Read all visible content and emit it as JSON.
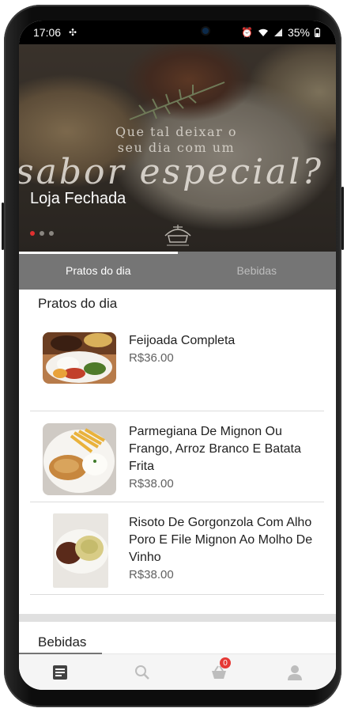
{
  "status_bar": {
    "time": "17:06",
    "battery": "35%"
  },
  "hero": {
    "line1": "Que tal deixar o seu dia com um",
    "line2": "sabor especial?",
    "store_status": "Loja Fechada"
  },
  "tabs": [
    {
      "label": "Pratos do dia",
      "active": true
    },
    {
      "label": "Bebidas",
      "active": false
    }
  ],
  "sections": {
    "pratos_title": "Pratos do dia",
    "bebidas_title": "Bebidas"
  },
  "menu_items": [
    {
      "name": "Feijoada Completa",
      "price": "R$36.00"
    },
    {
      "name": "Parmegiana De Mignon Ou Frango, Arroz Branco E Batata Frita",
      "price": "R$38.00"
    },
    {
      "name": "Risoto De Gorgonzola Com Alho Poro E File Mignon Ao Molho De Vinho",
      "price": "R$38.00"
    }
  ],
  "bottom_nav": {
    "items": [
      "menu-icon",
      "search-icon",
      "cart-icon",
      "profile-icon"
    ],
    "cart_badge": "0"
  },
  "colors": {
    "accent": "#e53935",
    "tab_bar": "#757575"
  }
}
